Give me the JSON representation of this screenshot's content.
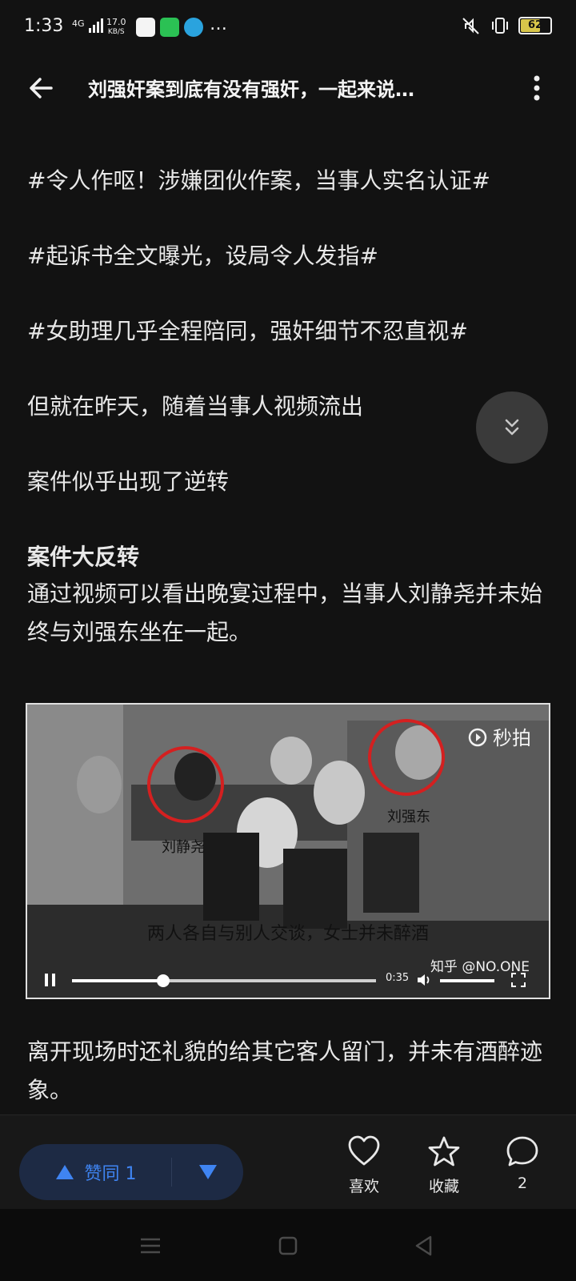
{
  "status_bar": {
    "time": "1:33",
    "network": "4G",
    "speed_value": "17.0",
    "speed_unit": "KB/S",
    "battery": "62",
    "more_icon": "…"
  },
  "header": {
    "title": "刘强奸案到底有没有强奸，一起来说…"
  },
  "article": {
    "paragraphs": [
      "#令人作呕！涉嫌团伙作案，当事人实名认证#",
      "#起诉书全文曝光，设局令人发指#",
      "#女助理几乎全程陪同，强奸细节不忍直视#",
      "但就在昨天，随着当事人视频流出",
      "案件似乎出现了逆转",
      "案件大反转",
      "通过视频可以看出晚宴过程中，当事人刘静尧并未始终与刘强东坐在一起。",
      "离开现场时还礼貌的给其它客人留门，并未有酒醉迹象。"
    ]
  },
  "video": {
    "brand": "秒拍",
    "label_left": "刘静尧",
    "label_right": "刘强东",
    "subtitle": "两人各自与别人交谈，女士并未醉酒",
    "watermark": "知乎 @NO.ONE",
    "current_time": "0:35",
    "progress": 0.3
  },
  "bottom_bar": {
    "vote_label": "赞同 1",
    "like_label": "喜欢",
    "favorite_label": "收藏",
    "comment_count": "2"
  }
}
